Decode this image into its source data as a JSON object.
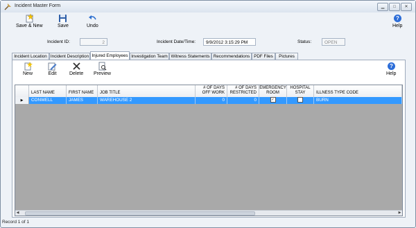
{
  "window": {
    "title": "Incident Master Form",
    "controls": [
      "minimize",
      "maximize",
      "close"
    ]
  },
  "toolbar": {
    "save_new": "Save & New",
    "save": "Save",
    "undo": "Undo",
    "help": "Help"
  },
  "header": {
    "incident_id_label": "Incident ID:",
    "incident_id_value": "2",
    "date_label": "Incident Date/Time:",
    "date_value": "9/9/2012 3:15:29 PM",
    "status_label": "Status:",
    "status_value": "OPEN"
  },
  "tabs": [
    {
      "label": "Incident Location"
    },
    {
      "label": "Incident Description"
    },
    {
      "label": "Injured Employees",
      "active": true
    },
    {
      "label": "Investigation Team"
    },
    {
      "label": "Witness Statements"
    },
    {
      "label": "Recommendations"
    },
    {
      "label": "PDF Files"
    },
    {
      "label": "Pictures"
    }
  ],
  "panel_toolbar": {
    "new": "New",
    "edit": "Edit",
    "delete": "Delete",
    "preview": "Preview",
    "help": "Help"
  },
  "grid": {
    "columns": {
      "last_name": "LAST NAME",
      "first_name": "FIRST NAME",
      "job_title": "JOB TITLE",
      "days_off": "# OF DAYS OFF WORK",
      "days_restricted": "# OF DAYS RESTRICTED",
      "emergency_room": "EMERGENCY ROOM",
      "hospital_stay": "HOSPITAL STAY",
      "illness_type": "ILLNESS TYPE CODE"
    },
    "rows": [
      {
        "last_name": "CONWELL",
        "first_name": "JAMES",
        "job_title": "WAREHOUSE 2",
        "days_off": "0",
        "days_restricted": "0",
        "emergency_room": true,
        "hospital_stay": false,
        "illness_type": "BURN"
      }
    ]
  },
  "status_bar": {
    "record_text": "Record 1 of 1"
  },
  "colors": {
    "selected_row": "#3399ff",
    "grid_background": "#a9a9a9"
  }
}
